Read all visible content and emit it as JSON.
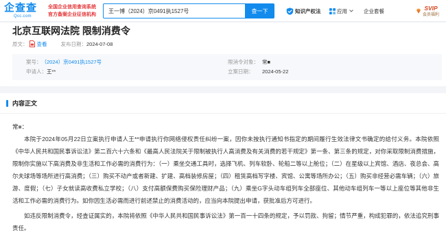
{
  "header": {
    "logo": {
      "name": "企查查",
      "domain": "Qcc.com"
    },
    "slogan": [
      "全国企业信用查询系统",
      "官方备案企业征信机构"
    ],
    "search": {
      "value": "王一博（2024）京0491执1527号",
      "button": "查一下"
    },
    "nav": {
      "ip_law": "知识产权法",
      "apps": "应用",
      "enterprise_package": "企业套餐",
      "svip": {
        "title": "SVIP",
        "subtitle": "会员福利"
      }
    }
  },
  "document": {
    "title": "北京互联网法院 限制消费令",
    "original_label": "原文：",
    "view_link": "查看",
    "publish_label": "发布日期：",
    "publish_date": "2024-07-08",
    "info": {
      "case_no_label": "案号：",
      "case_no": "（2024）京0491执1527号",
      "applicant_label": "申请人：",
      "applicant": "王**",
      "target_label": "限消令对象：",
      "target_name": "常",
      "target_mask": "■",
      "filed_label": "立案日期：",
      "filed_date": "2024-05-22"
    }
  },
  "content": {
    "section_title": "内容正文",
    "salutation": {
      "name": "常",
      "mask": "■",
      "colon": "："
    },
    "paragraphs": [
      "本院于2024年05月22日立案执行申请人王**申请执行你网络侵权责任纠纷一案，因你未按执行通知书指定的期间履行生效法律文书确定的给付义务。本院依照《中华人民共和国民事诉讼法》第二百六十六条和《最高人民法院关于限制被执行人高消费及有关消费的若干规定》第一条、第三条的规定，对你采取限制消费措施，限制你实施以下高消费及非生活和工作必需的消费行为：（一）乘坐交通工具时，选择飞机、列车软卧、轮船二等以上舱位；（二）在星级以上宾馆、酒店、夜总会、高尔夫球场等场所进行高消费；（三）购买不动产或者新建、扩建、高档装修房屋；（四）租赁高档写字楼、宾馆、公寓等场所办公；（五）购买非经营必需车辆；（六）旅游、度假；（七）子女就读高收费私立学校；（八）支付高额保费购买保险理财产品；（九）乘坐G字头动车组列车全部座位、其他动车组列车一等以上座位等其他非生活和工作必需的消费行为。如你因生活必需而进行前述禁止的消费活动的，应当向本院提出申请，获批准后方可进行。",
      "如违反限制消费令，经查证属实的，本院将依照《中华人民共和国民事诉讼法》第一百一十四条的规定，予以罚款、拘留；情节严重，构成犯罪的，依法追究刑事责任。"
    ]
  },
  "colors": {
    "brand_blue": "#128bed",
    "slogan_red": "#e4393c",
    "pdf_red": "#e8453c",
    "svip_orange": "#d4481f"
  },
  "icons": [
    "ip-law-icon",
    "apps-grid-icon",
    "chevron-down-icon",
    "svip-gem-icon",
    "pdf-icon"
  ]
}
